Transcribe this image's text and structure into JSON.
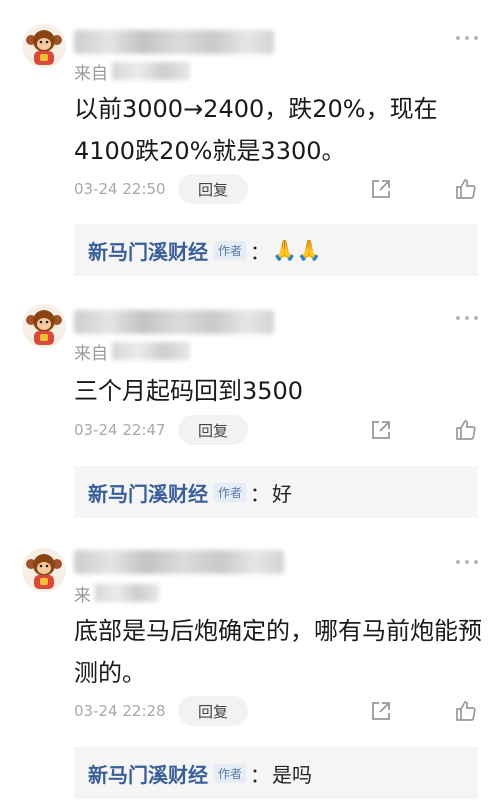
{
  "comments": [
    {
      "source_prefix": "来自",
      "text": "以前3000→2400，跌20%，现在4100跌20%就是3300。",
      "time": "03-24 22:50",
      "reply_label": "回复",
      "reply": {
        "author": "新马门溪财经",
        "badge": "作者",
        "colon": "：",
        "text": "🙏🙏"
      }
    },
    {
      "source_prefix": "来自",
      "text": "三个月起码回到3500",
      "time": "03-24 22:47",
      "reply_label": "回复",
      "reply": {
        "author": "新马门溪财经",
        "badge": "作者",
        "colon": "：",
        "text": "好"
      }
    },
    {
      "source_prefix": "来",
      "text": "底部是马后炮确定的，哪有马前炮能预测的。",
      "time": "03-24 22:28",
      "reply_label": "回复",
      "reply": {
        "author": "新马门溪财经",
        "badge": "作者",
        "colon": "：",
        "text": "是吗"
      }
    }
  ],
  "icons": {
    "more": "more-dots-icon",
    "share": "share-icon",
    "like": "thumbs-up-icon",
    "avatar": "monkey-avatar"
  },
  "colors": {
    "author": "#3a5f98",
    "meta": "#a8a8a8",
    "reply_bg": "#f5f5f5"
  }
}
